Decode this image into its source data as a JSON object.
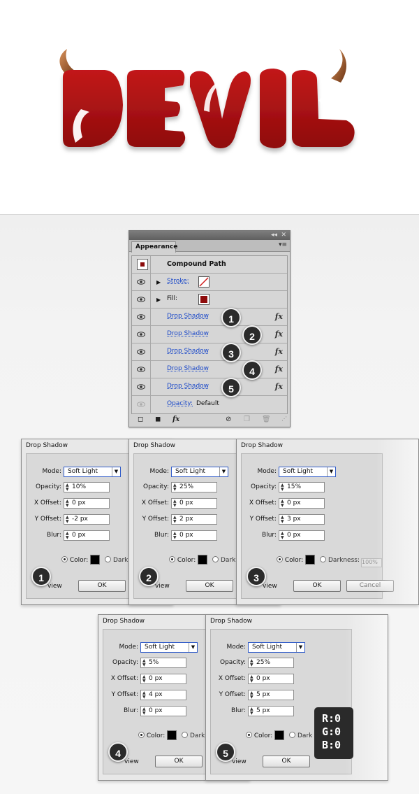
{
  "preview": {
    "word": "DEVIL",
    "letter_color": "#a80f10",
    "horn_color": "#8a4a22"
  },
  "appearance": {
    "tab_title": "Appearance",
    "object_title": "Compound Path",
    "stroke_label": "Stroke:",
    "fill_label": "Fill:",
    "fill_color": "#8e0b0b",
    "effects": [
      {
        "label": "Drop Shadow",
        "badge": "1"
      },
      {
        "label": "Drop Shadow",
        "badge": "2"
      },
      {
        "label": "Drop Shadow",
        "badge": "3"
      },
      {
        "label": "Drop Shadow",
        "badge": "4"
      },
      {
        "label": "Drop Shadow",
        "badge": "5"
      }
    ],
    "opacity_label": "Opacity:",
    "opacity_value": "Default",
    "fx_glyph": "fx"
  },
  "dialogs": [
    {
      "title": "Drop Shadow",
      "mode": "Soft Light",
      "opacity": "10%",
      "x_offset": "0 px",
      "y_offset": "-2 px",
      "blur": "0 px",
      "badge": "1",
      "color_label": "Color:",
      "dark_label": "Dark",
      "preview_label": "view",
      "ok": "OK"
    },
    {
      "title": "Drop Shadow",
      "mode": "Soft Light",
      "opacity": "25%",
      "x_offset": "0 px",
      "y_offset": "2 px",
      "blur": "0 px",
      "badge": "2",
      "color_label": "Color:",
      "dark_label": "Dark",
      "preview_label": "view",
      "ok": "OK"
    },
    {
      "title": "Drop Shadow",
      "mode": "Soft Light",
      "opacity": "15%",
      "x_offset": "0 px",
      "y_offset": "3 px",
      "blur": "0 px",
      "badge": "3",
      "color_label": "Color:",
      "dark_label": "Darkness:",
      "darkness_value": "100%",
      "preview_label": "view",
      "ok": "OK",
      "cancel": "Cancel"
    },
    {
      "title": "Drop Shadow",
      "mode": "Soft Light",
      "opacity": "5%",
      "x_offset": "0 px",
      "y_offset": "4 px",
      "blur": "0 px",
      "badge": "4",
      "color_label": "Color:",
      "dark_label": "Dark",
      "preview_label": "view",
      "ok": "OK"
    },
    {
      "title": "Drop Shadow",
      "mode": "Soft Light",
      "opacity": "25%",
      "x_offset": "0 px",
      "y_offset": "5 px",
      "blur": "5 px",
      "badge": "5",
      "color_label": "Color:",
      "dark_label": "Dark",
      "preview_label": "view",
      "ok": "OK"
    }
  ],
  "field_labels": {
    "mode": "Mode:",
    "opacity": "Opacity:",
    "x_offset": "X Offset:",
    "y_offset": "Y Offset:",
    "blur": "Blur:"
  },
  "rgb": {
    "r": "R:0",
    "g": "G:0",
    "b": "B:0"
  }
}
